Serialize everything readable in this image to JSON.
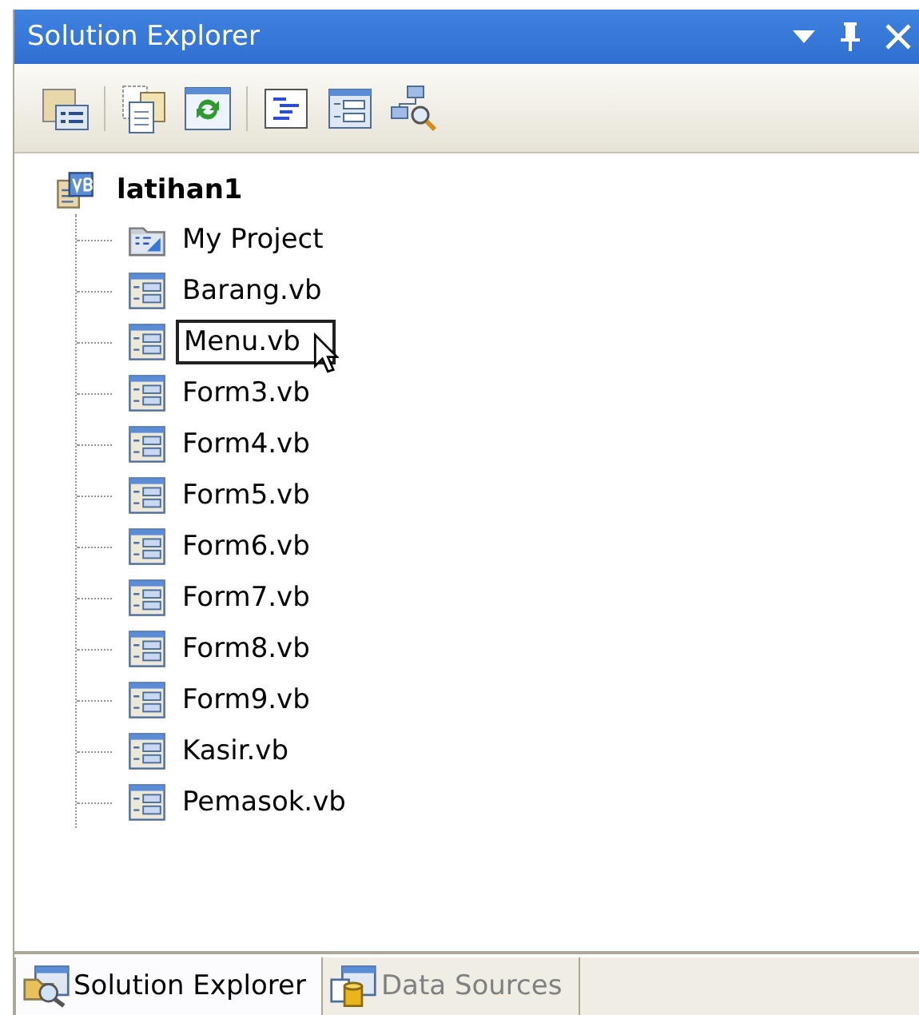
{
  "window": {
    "title": "Solution Explorer"
  },
  "tree": {
    "label": "latihan1",
    "children": [
      {
        "label": "My Project",
        "kind": "properties",
        "selected": false
      },
      {
        "label": "Barang.vb",
        "kind": "form",
        "selected": false
      },
      {
        "label": "Menu.vb",
        "kind": "form",
        "selected": true
      },
      {
        "label": "Form3.vb",
        "kind": "form",
        "selected": false
      },
      {
        "label": "Form4.vb",
        "kind": "form",
        "selected": false
      },
      {
        "label": "Form5.vb",
        "kind": "form",
        "selected": false
      },
      {
        "label": "Form6.vb",
        "kind": "form",
        "selected": false
      },
      {
        "label": "Form7.vb",
        "kind": "form",
        "selected": false
      },
      {
        "label": "Form8.vb",
        "kind": "form",
        "selected": false
      },
      {
        "label": "Form9.vb",
        "kind": "form",
        "selected": false
      },
      {
        "label": "Kasir.vb",
        "kind": "form",
        "selected": false
      },
      {
        "label": "Pemasok.vb",
        "kind": "form",
        "selected": false
      }
    ]
  },
  "tabs": [
    {
      "label": "Solution Explorer",
      "selected": true
    },
    {
      "label": "Data Sources",
      "selected": false
    }
  ]
}
